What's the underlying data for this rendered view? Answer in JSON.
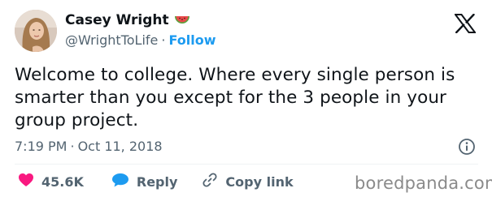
{
  "author": {
    "name": "Casey Wright",
    "emoji_icon": "watermelon-icon",
    "handle": "@WrightToLife",
    "separator": "·",
    "follow_label": "Follow"
  },
  "platform_icon": "x-logo-icon",
  "tweet": {
    "text": "Welcome to college. Where every single person is smarter than you except for the 3 people in your group project."
  },
  "meta": {
    "time": "7:19 PM",
    "separator": "·",
    "date": "Oct 11, 2018",
    "info_icon": "info-icon"
  },
  "actions": {
    "likes_count": "45.6K",
    "like_icon": "heart-icon",
    "reply_label": "Reply",
    "reply_icon": "reply-bubble-icon",
    "copy_label": "Copy link",
    "copy_icon": "link-icon"
  },
  "watermark": "boredpanda.com",
  "colors": {
    "text": "#0f1419",
    "secondary": "#536471",
    "accent": "#1d9bf0",
    "heart": "#f91880"
  }
}
